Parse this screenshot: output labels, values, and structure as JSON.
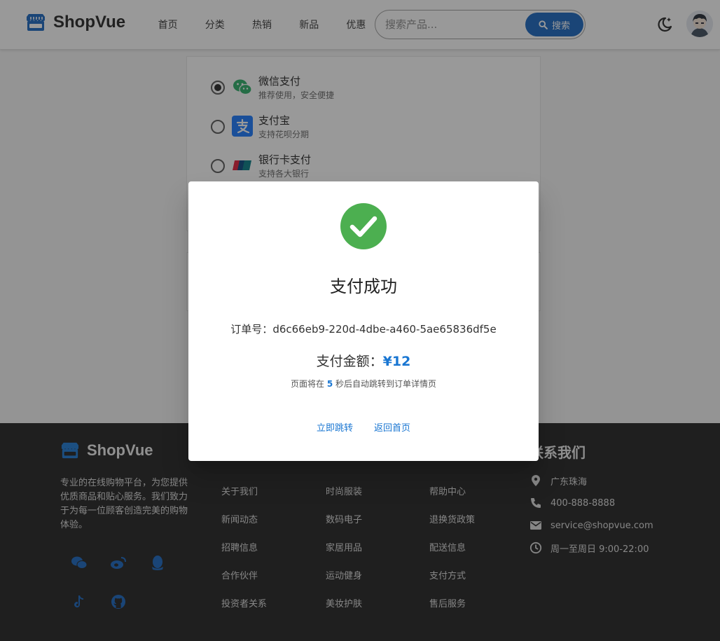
{
  "header": {
    "brand": "ShopVue",
    "nav": [
      "首页",
      "分类",
      "热销",
      "新品",
      "优惠"
    ],
    "search_placeholder": "搜索产品...",
    "search_button": "搜索"
  },
  "payment": {
    "options": [
      {
        "title": "微信支付",
        "subtitle": "推荐使用，安全便捷",
        "selected": true,
        "icon": "wechat-pay-icon"
      },
      {
        "title": "支付宝",
        "subtitle": "支持花呗分期",
        "selected": false,
        "icon": "alipay-icon"
      },
      {
        "title": "银行卡支付",
        "subtitle": "支持各大银行",
        "selected": false,
        "icon": "unionpay-icon"
      }
    ]
  },
  "dialog": {
    "title": "支付成功",
    "order_label": "订单号：",
    "order_id": "d6c66eb9-220d-4dbe-a460-5ae65836df5e",
    "amount_label": "支付金额：",
    "amount": "¥12",
    "redirect_prefix": "页面将在",
    "redirect_seconds": "5",
    "redirect_suffix": "秒后自动跳转到订单详情页",
    "btn_go": "立即跳转",
    "btn_home": "返回首页"
  },
  "footer": {
    "brand": "ShopVue",
    "description": "专业的在线购物平台，为您提供优质商品和贴心服务。我们致力于为每一位顾客创造完美的购物体验。",
    "col1": [
      "关于我们",
      "新闻动态",
      "招聘信息",
      "合作伙伴",
      "投资者关系"
    ],
    "col2": [
      "时尚服装",
      "数码电子",
      "家居用品",
      "运动健身",
      "美妆护肤"
    ],
    "col3": [
      "帮助中心",
      "退换货政策",
      "配送信息",
      "支付方式",
      "售后服务"
    ],
    "contact_title": "联系我们",
    "contact": {
      "address": "广东珠海",
      "phone": "400-888-8888",
      "email": "service@shopvue.com",
      "hours": "周一至周日 9:00-22:00"
    }
  },
  "colors": {
    "primary": "#1565c0",
    "success": "#4caf50",
    "footer_bg": "#1e1e1e",
    "link": "#1976d2"
  }
}
